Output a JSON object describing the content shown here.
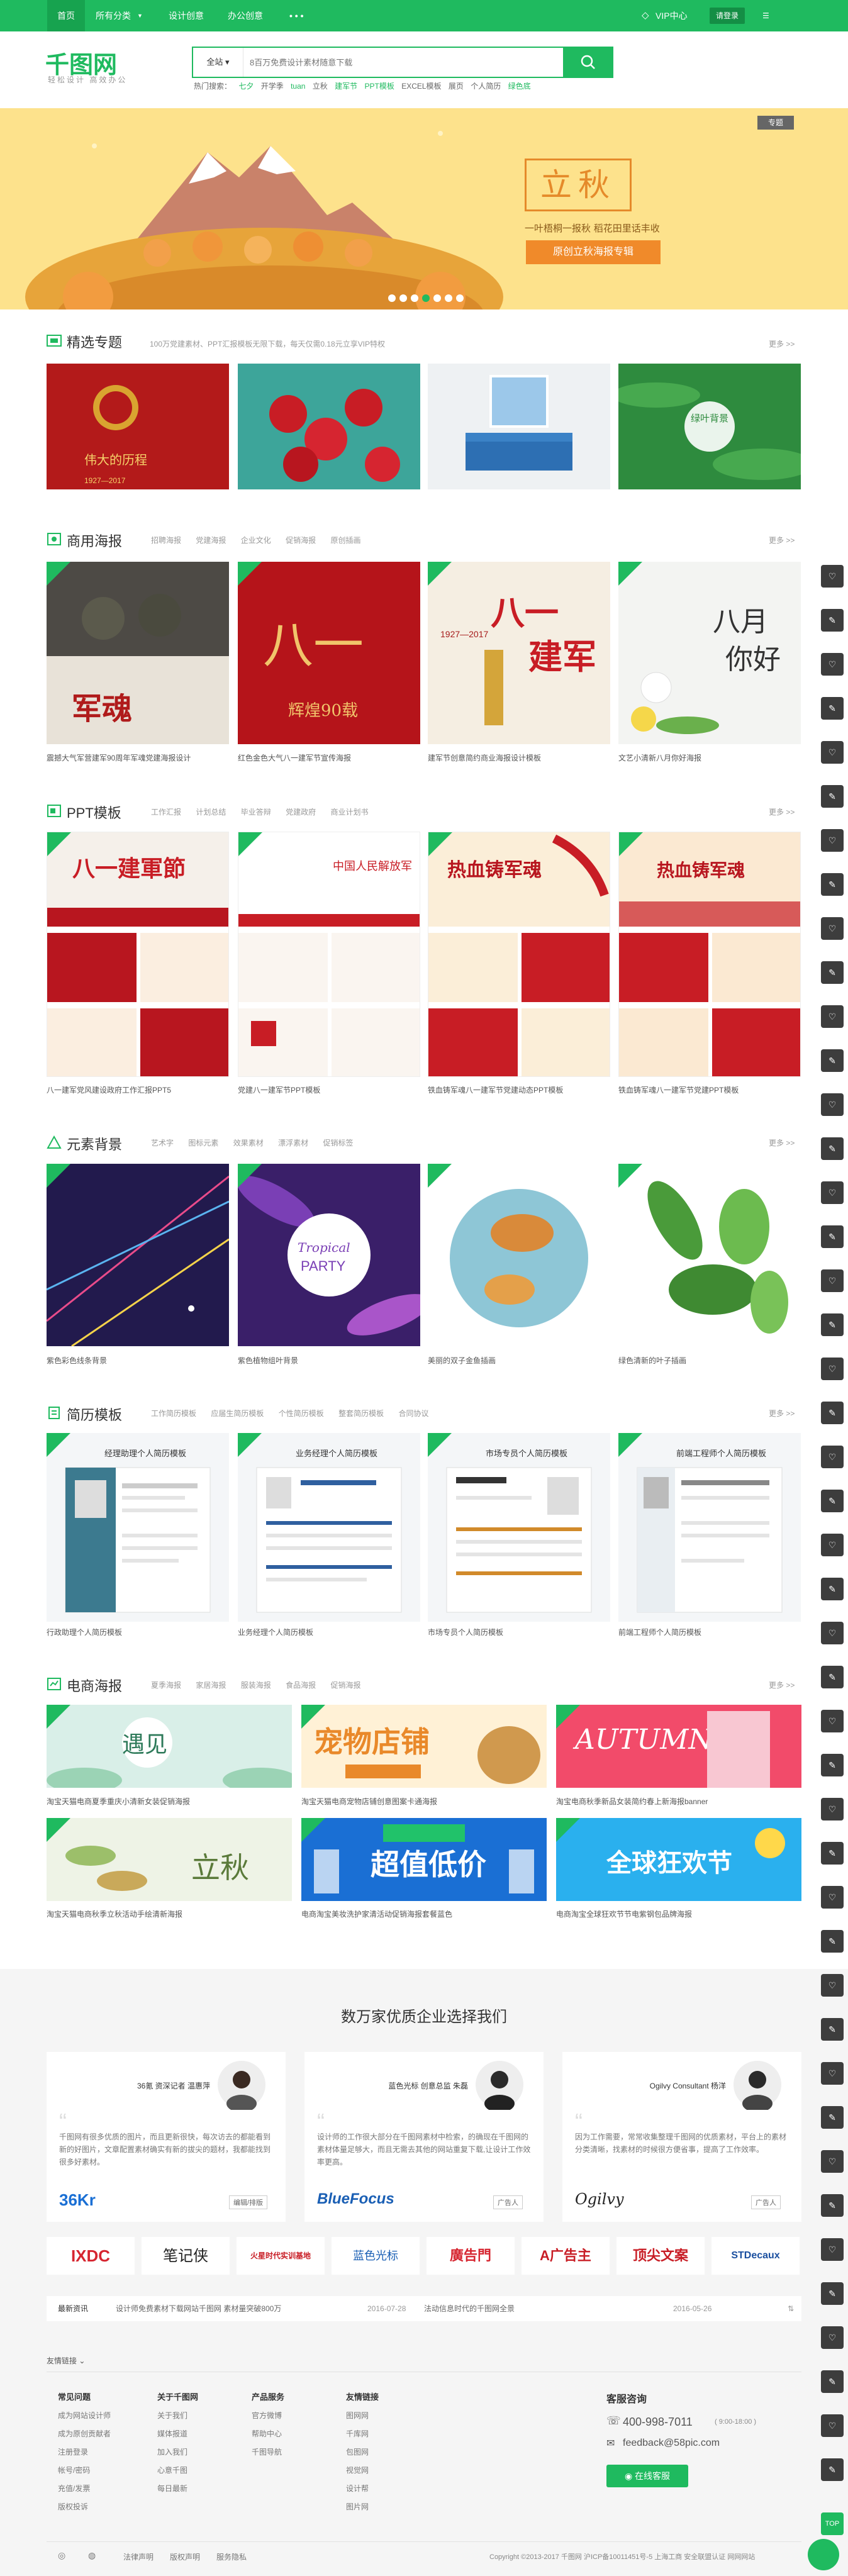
{
  "nav": {
    "home": "首页",
    "all": "所有分类",
    "design": "设计创意",
    "office": "办公创意",
    "more": "• • •",
    "vip": "VIP中心",
    "login": "请登录"
  },
  "brand": {
    "logo": "千图网",
    "slogan": "轻松设计 高效办公"
  },
  "search": {
    "scope": "全站",
    "placeholder": "8百万免费设计素材随意下载",
    "hot_label": "热门搜索：",
    "hot": [
      "七夕",
      "开学季",
      "tuan",
      "立秋",
      "建军节",
      "PPT模板",
      "EXCEL模板",
      "展页",
      "个人简历",
      "绿色底"
    ]
  },
  "banner": {
    "tag": "专题",
    "title": "立秋",
    "subtitle": "一叶梧桐一报秋  稻花田里话丰收",
    "button": "原创立秋海报专辑"
  },
  "sections": {
    "featured": {
      "title": "精选专题",
      "sub": "100万党建素材、PPT汇报模板无限下载，每天仅需0.18元立享VIP特权",
      "more": "更多 >>",
      "items": [
        {
          "caption": ""
        },
        {
          "caption": ""
        },
        {
          "caption": ""
        },
        {
          "caption": "绿叶背景"
        }
      ]
    },
    "poster": {
      "title": "商用海报",
      "tags": [
        "招聘海报",
        "党建海报",
        "企业文化",
        "促销海报",
        "原创插画"
      ],
      "more": "更多 >>",
      "items": [
        {
          "caption": "震撼大气军营建军90周年军魂党建海报设计",
          "art": "军魂"
        },
        {
          "caption": "红色金色大气八一建军节宣传海报",
          "art": "八一"
        },
        {
          "caption": "建军节创意简约商业海报设计模板",
          "art": "八一建军"
        },
        {
          "caption": "文艺小清新八月你好海报",
          "art": "八月你好"
        }
      ]
    },
    "ppt": {
      "title": "PPT模板",
      "tags": [
        "工作汇报",
        "计划总结",
        "毕业答辩",
        "党建政府",
        "商业计划书"
      ],
      "more": "更多 >>",
      "items": [
        {
          "caption": "八一建军党风建设政府工作汇报PPT5",
          "art": "八一建军节"
        },
        {
          "caption": "党建八一建军节PPT模板",
          "art": "中国人民解放军"
        },
        {
          "caption": "铁血铸军魂八一建军节党建动态PPT模板",
          "art": "热血铸军魂"
        },
        {
          "caption": "铁血铸军魂八一建军节党建PPT模板",
          "art": "热血铸军魂"
        }
      ]
    },
    "element": {
      "title": "元素背景",
      "tags": [
        "艺术字",
        "图标元素",
        "效果素材",
        "漂浮素材",
        "促销标签"
      ],
      "more": "更多 >>",
      "items": [
        {
          "caption": "紫色彩色线条背景"
        },
        {
          "caption": "紫色植物组叶背景",
          "art": "Tropical PARTY"
        },
        {
          "caption": "美丽的双子金鱼插画"
        },
        {
          "caption": "绿色清新的叶子插画"
        }
      ]
    },
    "resume": {
      "title": "简历模板",
      "tags": [
        "工作简历模板",
        "应届生简历模板",
        "个性简历模板",
        "整套简历模板",
        "合同协议"
      ],
      "more": "更多 >>",
      "items": [
        {
          "caption": "行政助理个人简历模板",
          "art": "经理助理个人简历模板"
        },
        {
          "caption": "业务经理个人简历模板",
          "art": "业务经理个人简历模板"
        },
        {
          "caption": "市场专员个人简历模板",
          "art": "市场专员个人简历模板"
        },
        {
          "caption": "前端工程师个人简历模板",
          "art": "前端工程师个人简历模板"
        }
      ]
    },
    "ecom": {
      "title": "电商海报",
      "tags": [
        "夏季海报",
        "家居海报",
        "服装海报",
        "食品海报",
        "促销海报"
      ],
      "more": "更多 >>",
      "items": [
        {
          "caption": "淘宝天猫电商夏季重庆小清新女装促销海报",
          "art": "遇见"
        },
        {
          "caption": "淘宝天猫电商宠物店铺创意图案卡通海报",
          "art": "宠物店铺"
        },
        {
          "caption": "淘宝电商秋季新品女装简约春上新海报banner",
          "art": "AUTUMN"
        },
        {
          "caption": "淘宝天猫电商秋季立秋活动手绘清新海报",
          "art": "立秋"
        },
        {
          "caption": "电商淘宝美妆洗护家清活动促销海报套餐蓝色",
          "art": "超值低价"
        },
        {
          "caption": "电商淘宝全球狂欢节节电紫钢包品牌海报",
          "art": "全球狂欢节"
        }
      ]
    }
  },
  "testimonials": {
    "title": "数万家优质企业选择我们",
    "items": [
      {
        "name": "36氪 资深记者 温惠萍",
        "text": "千图网有很多优质的图片，而且更新很快，每次访去的都能看到新的好图片，文章配置素材确实有新的拔尖的题材，我都能找到很多好素材。",
        "tag": "编辑/排版",
        "logo": "36Kr"
      },
      {
        "name": "蓝色光标 创意总监 朱磊",
        "text": "设计师的工作很大部分在千图网素材中检索，的确现在千图网的素材体量足够大，而且无需去其他的网站重复下载,让设计工作效率更高。",
        "tag": "广告人",
        "logo": "BlueFocus"
      },
      {
        "name": "Ogilvy Consultant 杨洋",
        "text": "因为工作需要，常常收集整理千图网的优质素材，平台上的素材分类清晰，找素材的时候很方便省事，提高了工作效率。",
        "tag": "广告人",
        "logo": "Ogilvy"
      }
    ]
  },
  "partners": [
    "IXDC",
    "笔记侠",
    "火星时代实训基地",
    "蓝色光标",
    "廣告門",
    "A广告主",
    "顶尖文案",
    "STDecaux"
  ],
  "news": {
    "label": "最新资讯",
    "items": [
      {
        "text": "设计师免费素材下载网站千图网 素材量突破800万",
        "date": "2016-07-28"
      },
      {
        "text": "法动信息时代的千图网全景",
        "date": "2016-05-26"
      }
    ]
  },
  "footer": {
    "friend_links": "友情链接",
    "cols": [
      {
        "title": "常见问题",
        "links": [
          "成为网站设计师",
          "成为原创贡献者",
          "注册登录",
          "帐号/密码",
          "充值/发票",
          "版权投诉"
        ]
      },
      {
        "title": "关于千图网",
        "links": [
          "关于我们",
          "媒体报道",
          "加入我们",
          "心意千图",
          "每日最新"
        ]
      },
      {
        "title": "产品服务",
        "links": [
          "官方微博",
          "帮助中心",
          "千图导航"
        ]
      },
      {
        "title": "友情链接",
        "links": [
          "图网网",
          "千库网",
          "包图网",
          "视觉网",
          "设计帮",
          "图片网"
        ]
      }
    ],
    "contact_title": "客服咨询",
    "phone": "400-998-7011",
    "hours": "( 9:00-18:00 )",
    "email": "feedback@58pic.com",
    "online": "在线客服",
    "bottom": [
      "法律声明",
      "版权声明",
      "服务隐私"
    ],
    "copyright": "Copyright ©2013-2017 千图网 沪ICP备10011451号-5  上海工商 安全联盟认证 网网网站"
  },
  "colors": {
    "brand": "#1fba5f",
    "dark": "#17a34f",
    "orange": "#f08a2a"
  }
}
